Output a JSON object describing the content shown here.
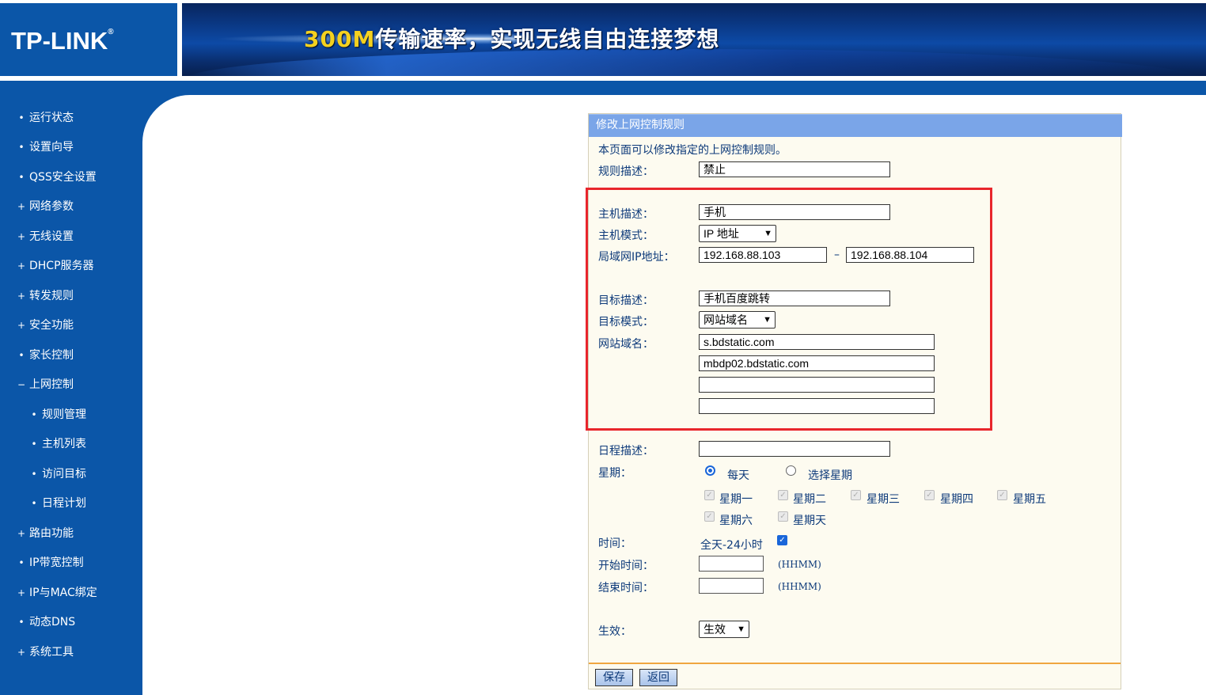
{
  "header": {
    "logo": "TP-LINK",
    "logo_mark": "®",
    "banner_highlight": "300M",
    "banner_text": "传输速率，实现无线自由连接梦想"
  },
  "sidebar": {
    "items": [
      {
        "marker": "•",
        "label": "运行状态"
      },
      {
        "marker": "•",
        "label": "设置向导"
      },
      {
        "marker": "•",
        "label": "QSS安全设置"
      },
      {
        "marker": "+",
        "label": "网络参数"
      },
      {
        "marker": "+",
        "label": "无线设置"
      },
      {
        "marker": "+",
        "label": "DHCP服务器"
      },
      {
        "marker": "+",
        "label": "转发规则"
      },
      {
        "marker": "+",
        "label": "安全功能"
      },
      {
        "marker": "•",
        "label": "家长控制"
      },
      {
        "marker": "−",
        "label": "上网控制"
      },
      {
        "marker": "•",
        "label": "规则管理"
      },
      {
        "marker": "•",
        "label": "主机列表"
      },
      {
        "marker": "•",
        "label": "访问目标"
      },
      {
        "marker": "•",
        "label": "日程计划"
      },
      {
        "marker": "+",
        "label": "路由功能"
      },
      {
        "marker": "•",
        "label": "IP带宽控制"
      },
      {
        "marker": "+",
        "label": "IP与MAC绑定"
      },
      {
        "marker": "•",
        "label": "动态DNS"
      },
      {
        "marker": "+",
        "label": "系统工具"
      }
    ]
  },
  "panel": {
    "title": "修改上网控制规则",
    "intro": "本页面可以修改指定的上网控制规则。",
    "rule_desc_label": "规则描述：",
    "rule_desc_value": "禁止",
    "host_desc_label": "主机描述：",
    "host_desc_value": "手机",
    "host_mode_label": "主机模式：",
    "host_mode_value": "IP 地址",
    "lan_ip_label": "局域网IP地址：",
    "ip_start": "192.168.88.103",
    "ip_sep": "–",
    "ip_end": "192.168.88.104",
    "target_desc_label": "目标描述：",
    "target_desc_value": "手机百度跳转",
    "target_mode_label": "目标模式：",
    "target_mode_value": "网站域名",
    "domain_label": "网站域名：",
    "domains": [
      "s.bdstatic.com",
      "mbdp02.bdstatic.com",
      "",
      ""
    ],
    "schedule_desc_label": "日程描述：",
    "schedule_desc_value": "",
    "week_label": "星期：",
    "radio_everyday": "每天",
    "radio_select": "选择星期",
    "days": [
      "星期一",
      "星期二",
      "星期三",
      "星期四",
      "星期五",
      "星期六",
      "星期天"
    ],
    "time_label": "时间：",
    "allday_text": "全天-24小时",
    "start_time_label": "开始时间：",
    "end_time_label": "结束时间：",
    "time_hint": "(HHMM)",
    "effect_label": "生效：",
    "effect_value": "生效",
    "save_button": "保存",
    "back_button": "返回"
  },
  "colors": {
    "nav_blue": "#0b56a8",
    "title_bar": "#7aa5e8",
    "highlight_red": "#e8262c",
    "divider_orange": "#f0a640"
  }
}
